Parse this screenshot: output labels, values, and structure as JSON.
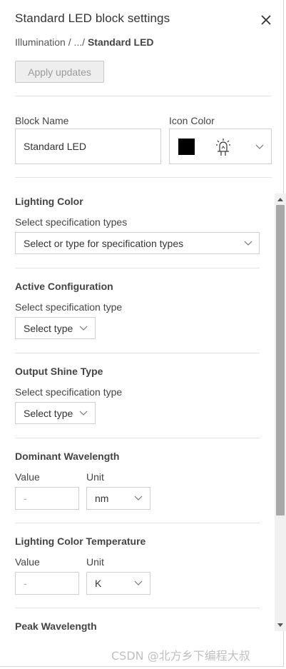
{
  "panel": {
    "title": "Standard LED block settings",
    "breadcrumb": {
      "root": "Illumination",
      "separator1": " / ",
      "ellipsis": "...",
      "separator2": "/ ",
      "current": "Standard LED"
    },
    "apply_button": "Apply updates"
  },
  "block_name": {
    "label": "Block Name",
    "value": "Standard LED"
  },
  "icon_color": {
    "label": "Icon Color",
    "swatch_color": "#000000",
    "icon": "led-icon"
  },
  "sections": {
    "lighting_color": {
      "title": "Lighting Color",
      "subtitle": "Select specification types",
      "select_placeholder": "Select or type for specification types"
    },
    "active_configuration": {
      "title": "Active Configuration",
      "subtitle": "Select specification type",
      "select_value": "Select type"
    },
    "output_shine_type": {
      "title": "Output Shine Type",
      "subtitle": "Select specification type",
      "select_value": "Select type"
    },
    "dominant_wavelength": {
      "title": "Dominant Wavelength",
      "value_label": "Value",
      "unit_label": "Unit",
      "value": "-",
      "unit": "nm"
    },
    "lighting_color_temperature": {
      "title": "Lighting Color Temperature",
      "value_label": "Value",
      "unit_label": "Unit",
      "value": "-",
      "unit": "K"
    },
    "peak_wavelength": {
      "title": "Peak Wavelength"
    }
  },
  "watermark": "CSDN @北方乡下编程大叔"
}
